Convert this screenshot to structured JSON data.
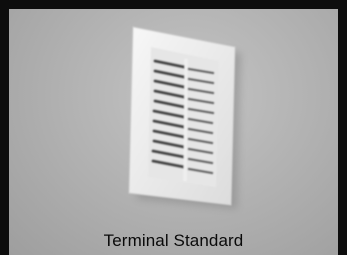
{
  "caption": "Terminal Standard",
  "image": {
    "subject": "vent-grille",
    "colors": {
      "border": "#0d0d0d",
      "wall": "#b5b5b5",
      "grille_frame": "#efefef",
      "louver_dark": "#3a3a3a"
    }
  }
}
